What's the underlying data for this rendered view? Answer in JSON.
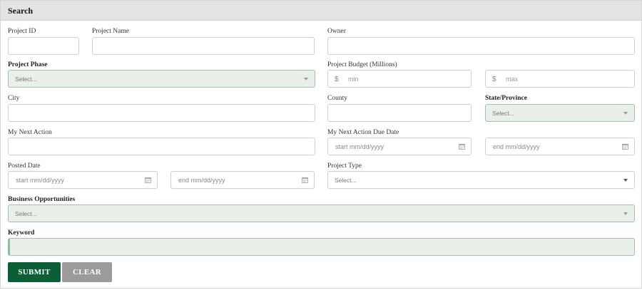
{
  "panel": {
    "title": "Search"
  },
  "fields": {
    "project_id": {
      "label": "Project ID",
      "value": ""
    },
    "project_name": {
      "label": "Project Name",
      "value": ""
    },
    "owner": {
      "label": "Owner",
      "value": ""
    },
    "project_phase": {
      "label": "Project Phase",
      "selected": "Select..."
    },
    "project_budget": {
      "label": "Project Budget (Millions)",
      "currency": "$",
      "min_placeholder": "min",
      "max_placeholder": "max"
    },
    "city": {
      "label": "City",
      "value": ""
    },
    "county": {
      "label": "County",
      "value": ""
    },
    "state_province": {
      "label": "State/Province",
      "selected": "Select..."
    },
    "my_next_action": {
      "label": "My Next Action",
      "value": ""
    },
    "my_next_action_due_date": {
      "label": "My Next Action Due Date",
      "start_placeholder": "start mm/dd/yyyy",
      "end_placeholder": "end mm/dd/yyyy"
    },
    "posted_date": {
      "label": "Posted Date",
      "start_placeholder": "start mm/dd/yyyy",
      "end_placeholder": "end mm/dd/yyyy"
    },
    "project_type": {
      "label": "Project Type",
      "selected": "Select..."
    },
    "business_opportunities": {
      "label": "Business Opportunities",
      "selected": "Select..."
    },
    "keyword": {
      "label": "Keyword",
      "value": ""
    }
  },
  "buttons": {
    "submit": "SUBMIT",
    "clear": "CLEAR"
  },
  "colors": {
    "submit_bg": "#0b5e36",
    "clear_bg": "#9b9b9b",
    "highlight_field_bg": "#e8f0e9",
    "header_bg": "#e3e3e3"
  },
  "icons": {
    "date_picker": "calendar-icon",
    "dropdown": "chevron-down-icon"
  }
}
